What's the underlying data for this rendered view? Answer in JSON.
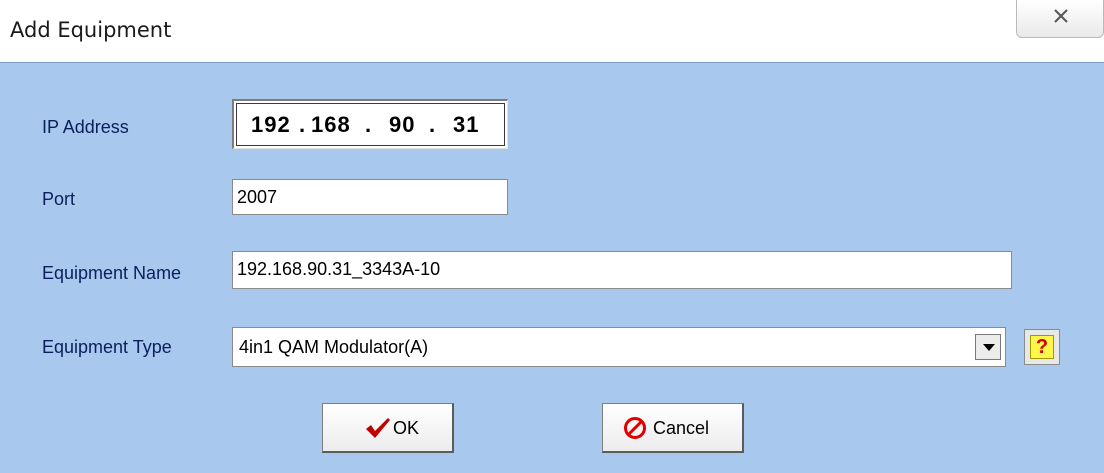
{
  "window": {
    "title": "Add Equipment",
    "close_icon": "close-x-icon"
  },
  "form": {
    "ip_label": "IP Address",
    "ip_octets": [
      "192",
      "168",
      "90",
      "31"
    ],
    "port_label": "Port",
    "port_value": "2007",
    "name_label": "Equipment Name",
    "name_value": "192.168.90.31_3343A-10",
    "type_label": "Equipment Type",
    "type_value": "4in1 QAM Modulator(A)",
    "help_label": "?"
  },
  "buttons": {
    "ok_label": "OK",
    "ok_icon": "checkmark-icon",
    "cancel_label": "Cancel",
    "cancel_icon": "prohibit-icon"
  },
  "colors": {
    "panel": "#a8c8ee",
    "label_text": "#0b1f5c",
    "ok_check": "#c00000",
    "cancel_symbol": "#e00000",
    "help_bg": "#fff84a"
  }
}
